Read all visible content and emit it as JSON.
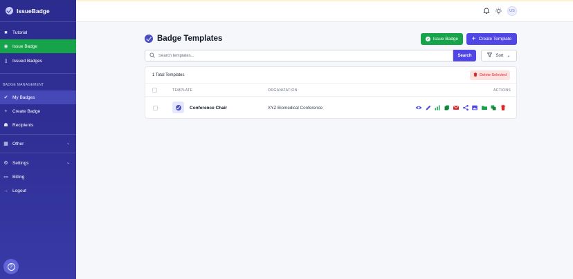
{
  "app": {
    "brand_name": "IssueBadge"
  },
  "sidebar": {
    "items_top": [
      {
        "label": "Tutorial",
        "icon": "video-icon"
      },
      {
        "label": "Issue Badge",
        "icon": "badge-icon",
        "active": true
      },
      {
        "label": "Issued Badges",
        "icon": "document-icon"
      }
    ],
    "section_label": "BADGE MANAGEMENT",
    "items_mgmt": [
      {
        "label": "My Badges",
        "icon": "check-circle-icon",
        "active": true
      },
      {
        "label": "Create Badge",
        "icon": "plus-icon"
      },
      {
        "label": "Recipients",
        "icon": "users-icon"
      }
    ],
    "other_label": "Other",
    "settings_label": "Settings",
    "billing_label": "Billing",
    "logout_label": "Logout"
  },
  "header": {
    "avatar_initials": "US"
  },
  "main": {
    "title": "Badge Templates",
    "issue_badge_label": "Issue Badge",
    "create_template_label": "Create Template",
    "search_placeholder": "Search templates...",
    "search_button_label": "Search",
    "sort_label": "Sort",
    "total_text": "1 Total Templates",
    "delete_selected_label": "Delete Selected",
    "columns": {
      "template": "TEMPLATE",
      "organization": "ORGANIZATION",
      "actions": "ACTIONS"
    },
    "rows": [
      {
        "template": "Conference Chair",
        "organization": "XYZ Biomedical Conference"
      }
    ],
    "action_icons": [
      {
        "name": "view-icon",
        "color": "#4f46e5"
      },
      {
        "name": "edit-icon",
        "color": "#4f46e5"
      },
      {
        "name": "stats-icon",
        "color": "#16a34a"
      },
      {
        "name": "copy-icon",
        "color": "#16a34a"
      },
      {
        "name": "email-icon",
        "color": "#dc2626"
      },
      {
        "name": "share-icon",
        "color": "#4f46e5"
      },
      {
        "name": "image-icon",
        "color": "#4f46e5"
      },
      {
        "name": "folder-icon",
        "color": "#16a34a"
      },
      {
        "name": "duplicate-icon",
        "color": "#16a34a"
      },
      {
        "name": "delete-icon",
        "color": "#dc2626"
      }
    ]
  },
  "colors": {
    "sidebar_bg": "#2c2c8f",
    "active_green": "#17a34a",
    "primary": "#4f46e5",
    "danger": "#dc2626"
  }
}
